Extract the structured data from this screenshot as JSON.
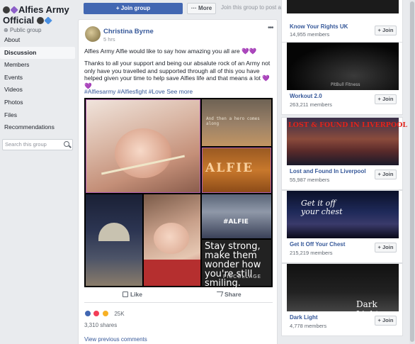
{
  "group": {
    "title": "Alfies Army Official",
    "privacy": "Public group"
  },
  "sidebar": {
    "items": [
      {
        "label": "About"
      },
      {
        "label": "Discussion"
      },
      {
        "label": "Members"
      },
      {
        "label": "Events"
      },
      {
        "label": "Videos"
      },
      {
        "label": "Photos"
      },
      {
        "label": "Files"
      },
      {
        "label": "Recommendations"
      }
    ],
    "active_index": 1,
    "search_placeholder": "Search this group"
  },
  "topbar": {
    "join_label": "+ Join group",
    "more_label": "··· More",
    "hint": "Join this group to post and comment."
  },
  "post": {
    "author": "Christina Byrne",
    "time": "5 hrs",
    "line1": "Alfies Army Alfie would like to say how amazing you all are 💜💜",
    "body": "Thanks to all your support and being our absalute rock of an Army not only have you travelled and supported through all of this you have helped given your time to help save Alfies life and that means a lot 💜💜",
    "hashtags": "#Alfiesarmy #Alfiesfight #Love",
    "see_more": "See more",
    "collage_captions": {
      "tile2": "And then a hero comes along",
      "tile3": "ALFIE",
      "tile6": "#ALFIE",
      "tile7": "Stay strong, make them wonder how you're still smiling.",
      "watermark": "PICCOLLAGE"
    },
    "actions": {
      "like": "Like",
      "share": "Share"
    },
    "reaction_count": "25K",
    "shares": "3,310 shares",
    "prev_comments": "View previous comments"
  },
  "suggestions": [
    {
      "name": "Know Your Rights UK",
      "members": "14,955 members",
      "join": "+ Join",
      "image_caption": ""
    },
    {
      "name": "Workout 2.0",
      "members": "263,211 members",
      "join": "+ Join",
      "image_caption": "PitBull Fitness"
    },
    {
      "name": "Lost and Found In Liverpool",
      "members": "55,987 members",
      "join": "+ Join",
      "image_caption": "LOST & FOUND IN LIVERPOOL"
    },
    {
      "name": "Get It Off Your Chest",
      "members": "215,219 members",
      "join": "+ Join",
      "image_caption": "Get it off your chest"
    },
    {
      "name": "Dark Light",
      "members": "4,778 members",
      "join": "+ Join",
      "image_caption": "Dark Light"
    }
  ],
  "colors": {
    "brand_blue": "#4267b2",
    "link_blue": "#365899",
    "page_bg": "#e9ebee"
  }
}
